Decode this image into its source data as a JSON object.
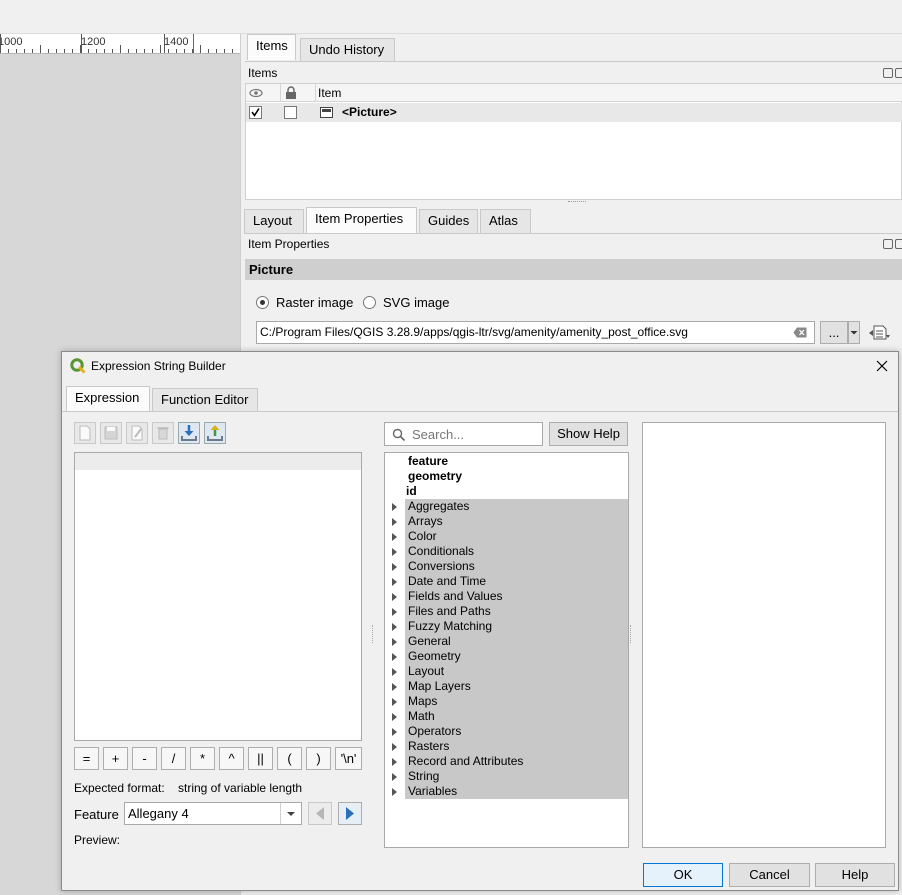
{
  "ruler": {
    "labels": [
      "1000",
      "1200",
      "1400"
    ]
  },
  "dock_top": {
    "tabs": [
      "Items",
      "Undo History"
    ],
    "panel_title": "Items",
    "columns": [
      "Item"
    ],
    "rows": [
      {
        "visible": true,
        "locked": false,
        "name": "<Picture>"
      }
    ]
  },
  "dock_bottom": {
    "tabs": [
      "Layout",
      "Item Properties",
      "Guides",
      "Atlas"
    ],
    "panel_title": "Item Properties",
    "section_title": "Picture",
    "source_type": {
      "options": [
        "Raster image",
        "SVG image"
      ],
      "selected": "Raster image"
    },
    "path_value": "C:/Program Files/QGIS 3.28.9/apps/qgis-ltr/svg/amenity/amenity_post_office.svg",
    "browse_label": "..."
  },
  "dialog": {
    "title": "Expression String Builder",
    "tabs": [
      "Expression",
      "Function Editor"
    ],
    "operators": [
      "=",
      "+",
      "-",
      "/",
      "*",
      "^",
      "||",
      "(",
      ")",
      "'\\n'"
    ],
    "expected_format_label": "Expected format:",
    "expected_format_value": "string of variable length",
    "feature_label": "Feature",
    "feature_value": "Allegany 4",
    "preview_label": "Preview:",
    "search_placeholder": "Search...",
    "show_help_label": "Show Help",
    "tree": {
      "plain": [
        "feature",
        "geometry",
        "id"
      ],
      "groups": [
        "Aggregates",
        "Arrays",
        "Color",
        "Conditionals",
        "Conversions",
        "Date and Time",
        "Fields and Values",
        "Files and Paths",
        "Fuzzy Matching",
        "General",
        "Geometry",
        "Layout",
        "Map Layers",
        "Maps",
        "Math",
        "Operators",
        "Rasters",
        "Record and Attributes",
        "String",
        "Variables"
      ]
    },
    "buttons": {
      "ok": "OK",
      "cancel": "Cancel",
      "help": "Help"
    }
  },
  "colors": {
    "accent": "#0078d7",
    "qgis_green": "#589632",
    "ruler_marker": "#d23a3a"
  }
}
